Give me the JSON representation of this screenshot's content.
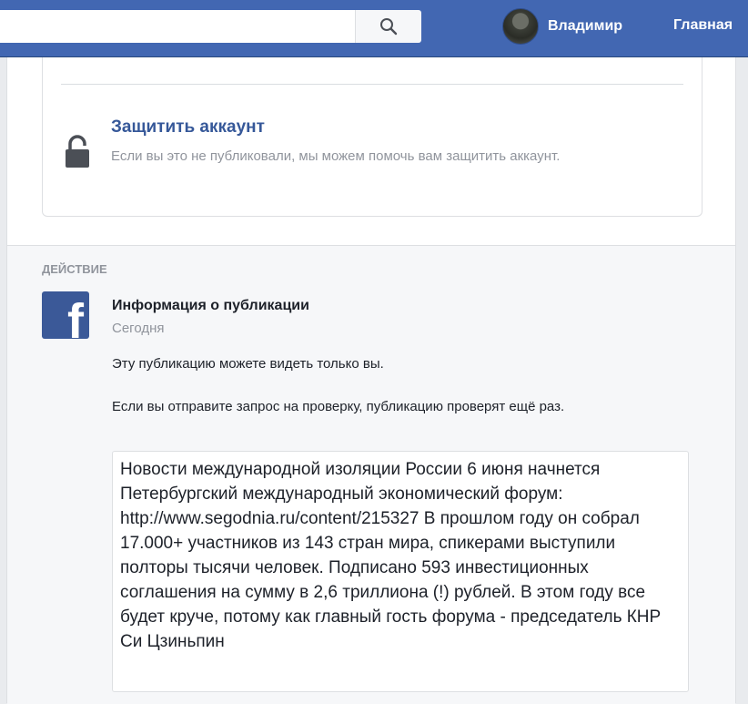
{
  "topbar": {
    "search_placeholder": "",
    "user_name": "Владимир",
    "home_label": "Главная"
  },
  "protect": {
    "title": "Защитить аккаунт",
    "description": "Если вы это не публиковали, мы можем помочь вам защитить аккаунт."
  },
  "action": {
    "section_label": "ДЕЙСТВИЕ",
    "title": "Информация о публикации",
    "date": "Сегодня",
    "visibility": "Эту публикацию можете видеть только вы.",
    "review_note": "Если вы отправите запрос на проверку, публикацию проверят ещё раз.",
    "post_text": "Новости международной изоляции России 6 июня начнется Петербургский международный экономический форум: http://www.segodnia.ru/content/215327 В прошлом году он собрал 17.000+ участников из 143 стран мира, спикерами выступили полторы тысячи человек. Подписано 593 инвестиционных соглашения на сумму в 2,6 триллиона (!) рублей. В этом году все будет круче, потому как главный гость форума - председатель КНР Си Цзиньпин"
  },
  "icons": {
    "search": "search-icon",
    "lock": "lock-icon",
    "facebook": "facebook-logo-icon"
  },
  "colors": {
    "topbar": "#4267b2",
    "link": "#365899",
    "facebook_logo": "#3b5998"
  }
}
